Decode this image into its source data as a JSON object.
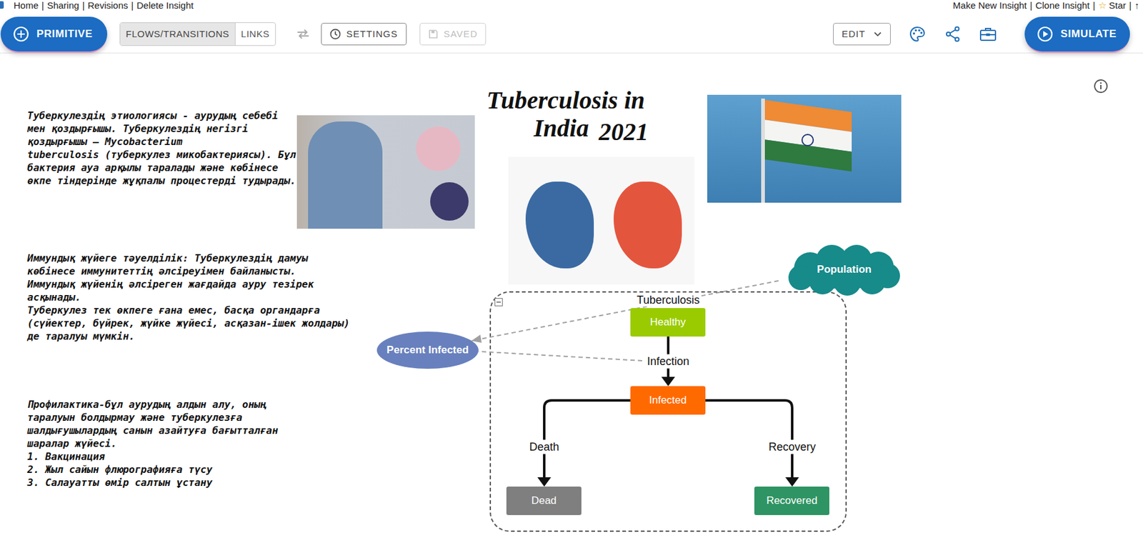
{
  "header": {
    "left_links": [
      "Home",
      "Sharing",
      "Revisions",
      "Delete Insight"
    ],
    "right_links": [
      {
        "label": "Make New Insight"
      },
      {
        "label": "Clone Insight"
      },
      {
        "glyph": "☆",
        "label": "Star"
      },
      {
        "label": "↑"
      }
    ],
    "separator": "|"
  },
  "toolbar": {
    "primitive": "PRIMITIVE",
    "modes": [
      {
        "label": "FLOWS/TRANSITIONS",
        "selected": true
      },
      {
        "label": "LINKS",
        "selected": false
      }
    ],
    "settings": "SETTINGS",
    "saved": {
      "label": "SAVED",
      "disabled": true
    },
    "edit": "EDIT",
    "simulate": "SIMULATE"
  },
  "notes": [
    {
      "lines": [
        "Туберкулездің этиологиясы - аурудың себебі",
        "мен қоздырғышы. Туберкулездің негізгі",
        "қоздырғышы — Mycobacterium",
        "tuberculosis (туберкулез микобактериясы). Бұл",
        "бактерия ауа арқылы таралады және көбінесе",
        "өкпе тіндерінде жұқпалы процестерді тудырады."
      ]
    },
    {
      "lines": [
        "Иммундық жүйеге тәуелділік: Туберкулездің дамуы",
        "көбінесе иммунитеттің әлсіреуімен байланысты.",
        "Иммундық жүйенің әлсіреген жағдайда ауру тезірек",
        "асқынады.",
        "Туберкулез тек өкпеге ғана емес, басқа органдарға",
        "(сүйектер, бүйрек, жүйке жүйесі, асқазан-ішек жолдары)",
        "де таралуы мүмкін."
      ]
    },
    {
      "lines": [
        "Профилактика-бұл аурудың алдын алу, оның",
        "таралуын болдырмау және туберкулезға",
        "шалдығушылардың санын азайтуға бағытталған",
        "шаралар жүйесі.",
        "1. Вакцинация",
        "2. Жыл сайын флюрографияға түсу",
        "3. Салауатты өмір салтын ұстану"
      ]
    }
  ],
  "title": {
    "line1": "Tuberculosis in",
    "country": "India",
    "year": "2021"
  },
  "diagram": {
    "folder": {
      "label": "Tuberculosis",
      "expanded": true
    },
    "stocks": [
      {
        "name": "Healthy",
        "color": "#9acb00"
      },
      {
        "name": "Infected",
        "color": "#ff6a00"
      },
      {
        "name": "Dead",
        "color": "#7f7f7f"
      },
      {
        "name": "Recovered",
        "color": "#2f9463"
      }
    ],
    "flows": [
      {
        "name": "Infection"
      },
      {
        "name": "Death"
      },
      {
        "name": "Recovery"
      }
    ],
    "variables": [
      {
        "name": "Population",
        "kind": "cloud",
        "color": "#178a8a"
      },
      {
        "name": "Percent Infected",
        "kind": "ellipse",
        "color": "#6880bd"
      }
    ]
  }
}
